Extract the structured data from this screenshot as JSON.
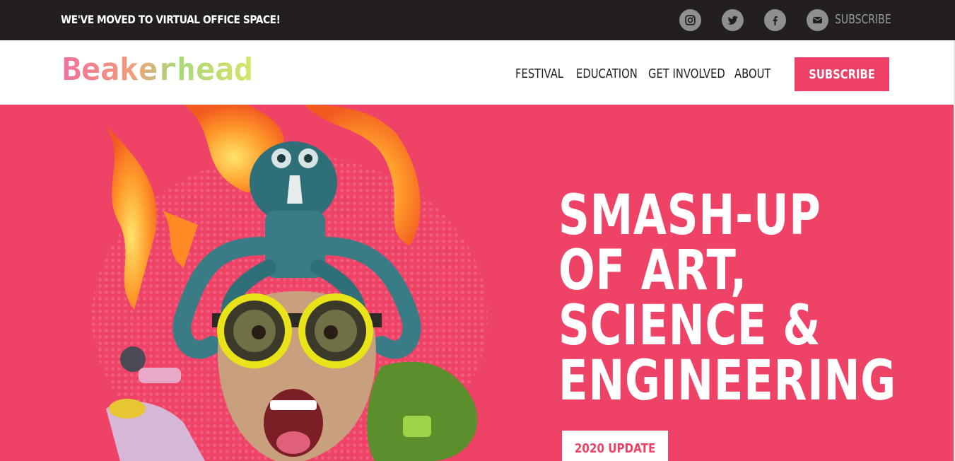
{
  "topbar": {
    "notice": "WE'VE MOVED TO VIRTUAL OFFICE SPACE!",
    "social_icons": [
      "instagram-icon",
      "twitter-icon",
      "facebook-icon",
      "mail-icon"
    ],
    "subscribe_label": "SUBSCRIBE"
  },
  "header": {
    "logo_text": "Beakerhead",
    "nav": [
      "FESTIVAL",
      "EDUCATION",
      "GET INVOLVED",
      "ABOUT"
    ],
    "subscribe_label": "SUBSCRIBE"
  },
  "hero": {
    "headline_lines": [
      "SMASH-UP",
      "OF ART,",
      "SCIENCE &",
      "ENGINEERING"
    ],
    "cta_label": "2020 UPDATE"
  },
  "colors": {
    "topbar_bg": "#231f20",
    "brand_pink": "#ee3f66",
    "hero_bg": "#ef4267",
    "icon_grey": "#8f8f8f"
  }
}
